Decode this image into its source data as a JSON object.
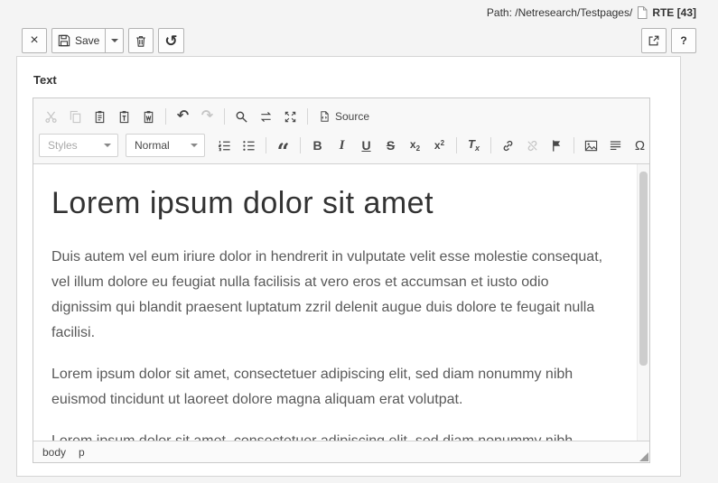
{
  "header": {
    "path_label": "Path: /Netresearch/Testpages/",
    "record_title": "RTE [43]"
  },
  "docheader": {
    "close_glyph": "×",
    "save_label": "Save",
    "history_glyph": "↺",
    "help_label": "?"
  },
  "panel": {
    "field_label": "Text"
  },
  "editor": {
    "toolbar": {
      "styles_label": "Styles",
      "format_label": "Normal",
      "source_label": "Source",
      "undo_glyph": "↶",
      "redo_glyph": "↷",
      "quote_glyph": "“",
      "bold": "B",
      "italic": "I",
      "underline": "U",
      "strike": "S",
      "sub_base": "x",
      "sub_mark": "2",
      "sup_base": "x",
      "sup_mark": "2",
      "removeformat_base": "T",
      "removeformat_mark": "x",
      "omega_glyph": "Ω"
    },
    "content": {
      "heading": "Lorem ipsum dolor sit amet",
      "paragraphs": [
        "Duis autem vel eum iriure dolor in hendrerit in vulputate velit esse molestie consequat, vel illum dolore eu feugiat nulla facilisis at vero eros et accumsan et iusto odio dignissim qui blandit praesent luptatum zzril delenit augue duis dolore te feugait nulla facilisi.",
        "Lorem ipsum dolor sit amet, consectetuer adipiscing elit, sed diam nonummy nibh euismod tincidunt ut laoreet dolore magna aliquam erat volutpat.",
        "Lorem ipsum dolor sit amet, consectetuer adipiscing elit, sed diam nonummy nibh euismod tincidunt ut laoreet dolore magna aliquam erat volutpat."
      ]
    },
    "statusbar": {
      "items": [
        "body",
        "p"
      ]
    }
  },
  "colors": {
    "page_bg": "#f4f4f4",
    "toolbar_bg": "#f8f8f8",
    "border": "#d1d1d1",
    "text": "#333333",
    "body_text": "#595959",
    "disabled": "#c6c6c6"
  }
}
